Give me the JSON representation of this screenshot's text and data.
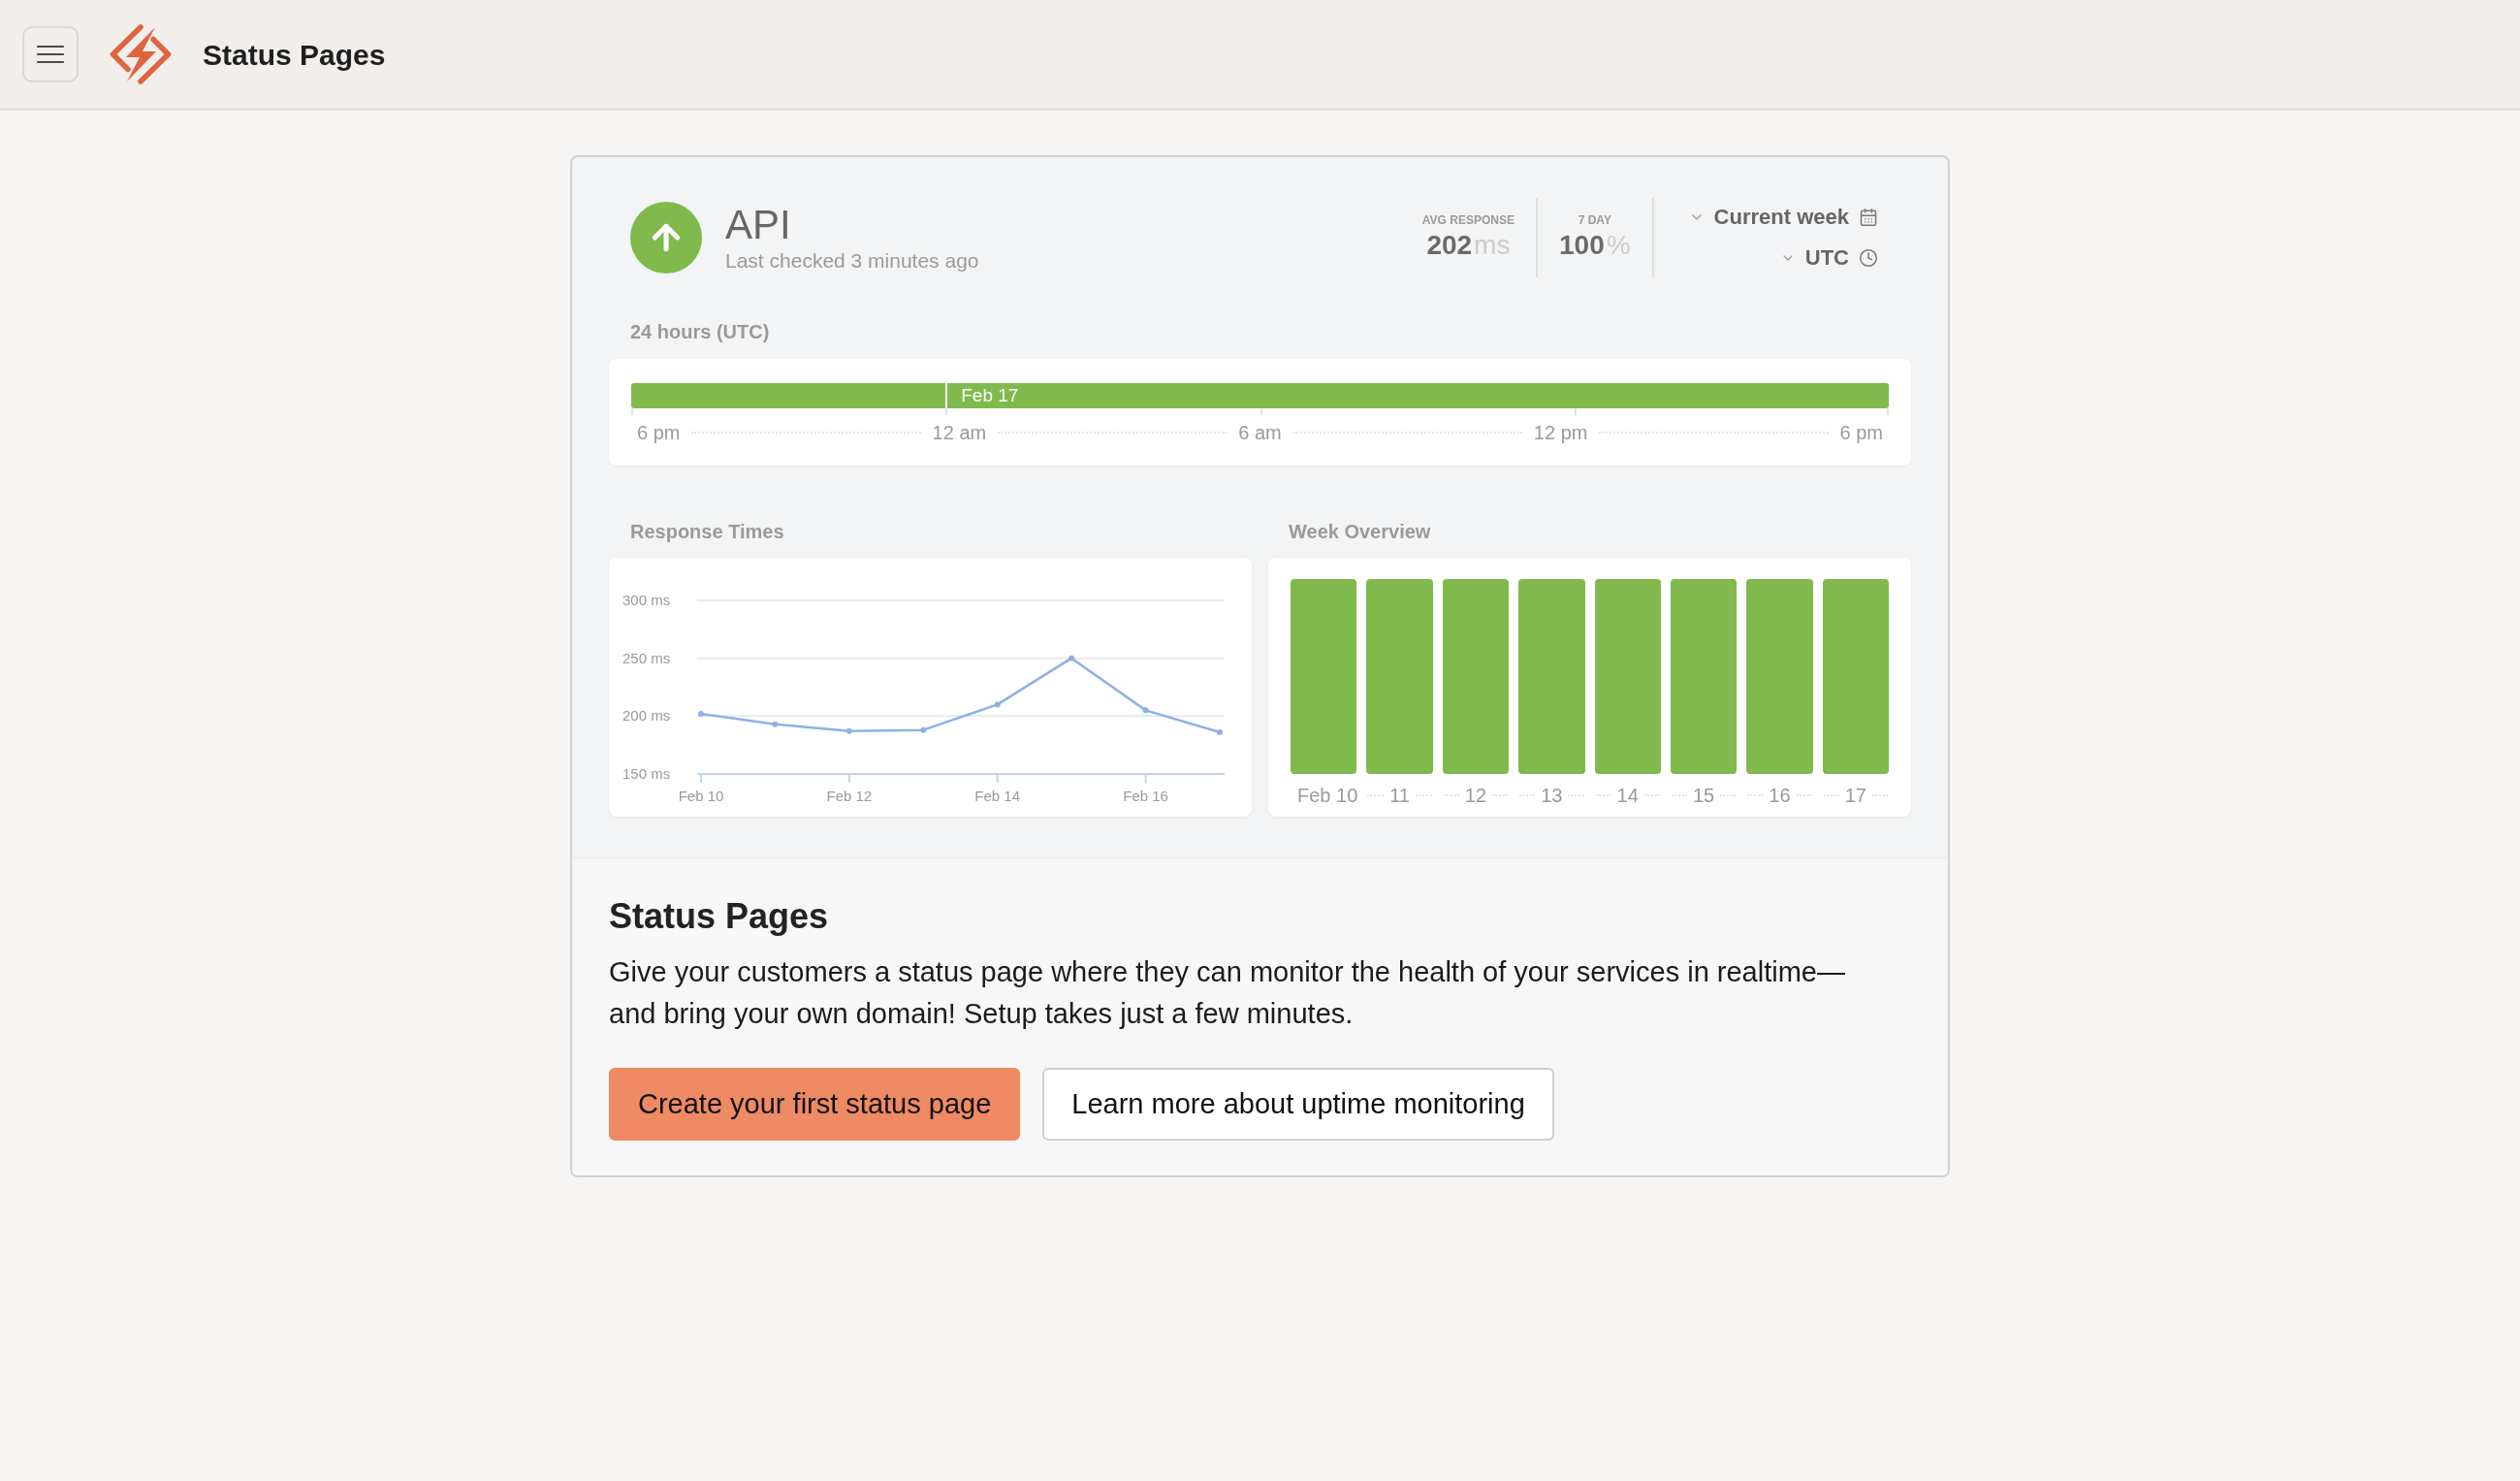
{
  "app_bar": {
    "title": "Status Pages"
  },
  "monitor": {
    "name": "API",
    "up": true,
    "last_checked": "Last checked 3 minutes ago",
    "stats": [
      {
        "label": "AVG RESPONSE",
        "value": "202",
        "unit": "ms"
      },
      {
        "label": "7 DAY",
        "value": "100",
        "unit": "%"
      }
    ],
    "filters": [
      {
        "label": "Current week",
        "kind": "date"
      },
      {
        "label": "UTC",
        "kind": "timezone"
      }
    ]
  },
  "timeline": {
    "title": "24 hours (UTC)",
    "up": true,
    "ticks": [
      {
        "label": "6 pm"
      },
      {
        "label": "12 am",
        "day": "Feb 17"
      },
      {
        "label": "6 am"
      },
      {
        "label": "12 pm"
      },
      {
        "label": "6 pm"
      }
    ]
  },
  "response_times": {
    "chart_data": {
      "type": "line",
      "title": "Response Times",
      "categories": [
        "Feb 10",
        null,
        "Feb 12",
        null,
        "Feb 14",
        null,
        "Feb 16",
        null
      ],
      "series": [
        {
          "color": "#8db1e6",
          "marker": true,
          "values": [
            202,
            193,
            187,
            188,
            210,
            250,
            205,
            186
          ]
        }
      ],
      "ylim": [
        150,
        300
      ],
      "yticks": [
        {
          "value": 300,
          "label": "300 ms"
        },
        {
          "value": 250,
          "label": "250 ms"
        },
        {
          "value": 200,
          "label": "200 ms"
        },
        {
          "value": 150,
          "label": "150 ms"
        }
      ]
    }
  },
  "week_overview": {
    "title": "Week Overview",
    "days": [
      {
        "label": "Feb 10",
        "up": true
      },
      {
        "label": "11",
        "up": true
      },
      {
        "label": "12",
        "up": true
      },
      {
        "label": "13",
        "up": true
      },
      {
        "label": "14",
        "up": true
      },
      {
        "label": "15",
        "up": true
      },
      {
        "label": "16",
        "up": true
      },
      {
        "label": "17",
        "up": true
      }
    ]
  },
  "promo": {
    "title": "Status Pages",
    "text": "Give your customers a status page where they can monitor the health of your services in realtime—and bring your own domain! Setup takes just a few minutes.",
    "buttons": [
      {
        "label": "Create your first status page",
        "kind": "primary"
      },
      {
        "label": "Learn more about uptime monitoring",
        "kind": "secondary"
      }
    ]
  }
}
